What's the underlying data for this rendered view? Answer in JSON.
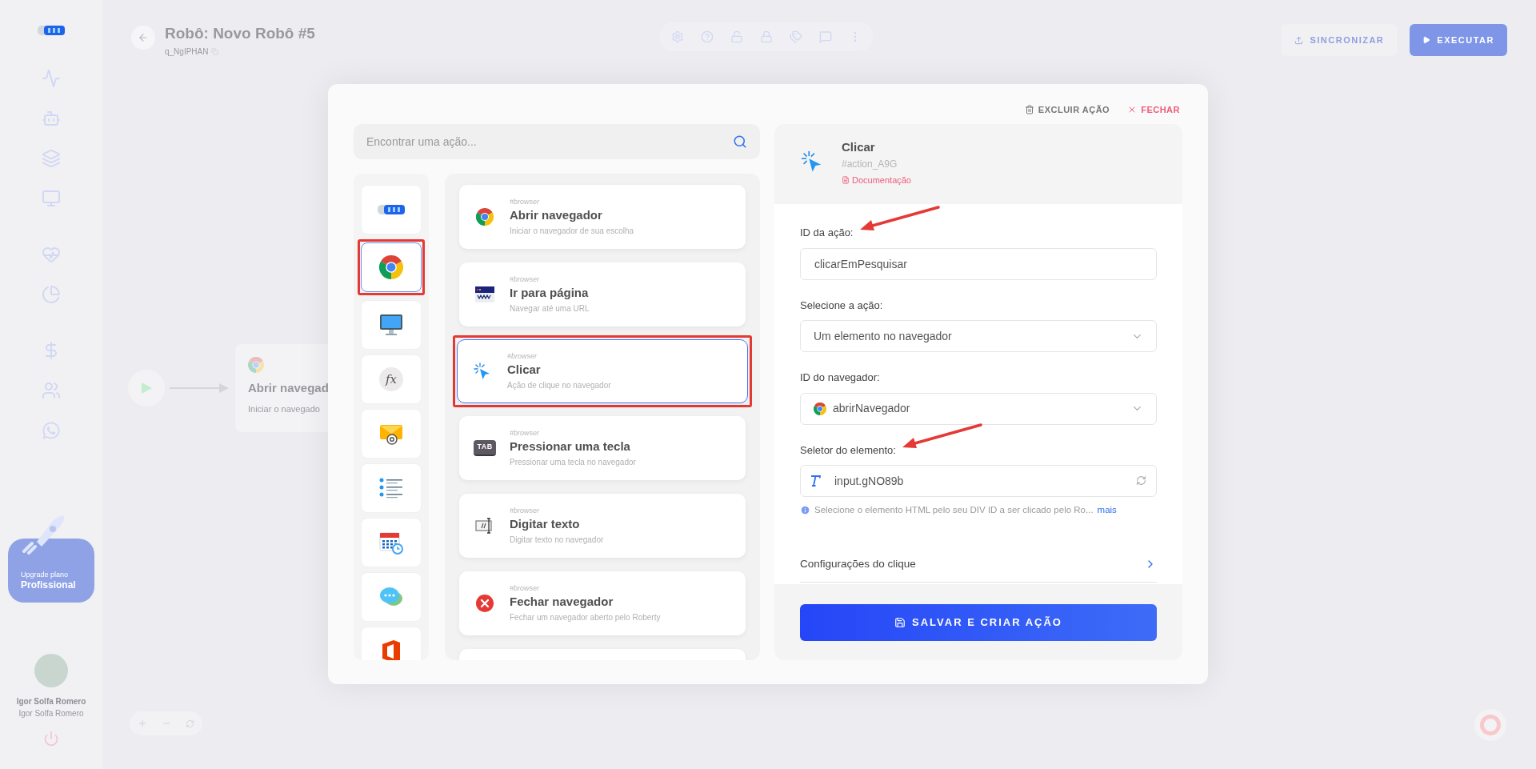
{
  "header": {
    "title": "Robô: Novo Robô #5",
    "robot_id": "q_NgIPHAN"
  },
  "sidebar": {
    "items": [
      {
        "kind": "activity"
      },
      {
        "kind": "robot"
      },
      {
        "kind": "layers"
      },
      {
        "kind": "monitor"
      },
      {
        "kind": "health"
      },
      {
        "kind": "chart"
      },
      {
        "kind": "money"
      },
      {
        "kind": "users"
      },
      {
        "kind": "whatsapp"
      }
    ],
    "upgrade": {
      "line1": "Upgrade plano",
      "line2": "Profissional"
    },
    "user": {
      "name": "Igor Solfa Romero",
      "subtitle": "Igor Solfa Romero"
    }
  },
  "toolbar": [
    {
      "kind": "settings"
    },
    {
      "kind": "help"
    },
    {
      "kind": "unlock"
    },
    {
      "kind": "lock"
    },
    {
      "kind": "tags"
    },
    {
      "kind": "chat"
    },
    {
      "kind": "more"
    }
  ],
  "header_buttons": [
    {
      "label": "SINCRONIZAR",
      "kind": "secondary"
    },
    {
      "label": "EXECUTAR",
      "kind": "primary"
    }
  ],
  "canvas": {
    "node": {
      "title": "Abrir navegad",
      "subtitle": "Iniciar o navegado"
    }
  },
  "modal": {
    "top_actions": [
      {
        "label": "EXCLUIR AÇÃO",
        "kind": "delete"
      },
      {
        "label": "FECHAR",
        "kind": "close"
      }
    ],
    "search": {
      "placeholder": "Encontrar uma ação..."
    },
    "categories": [
      {
        "kind": "scanner",
        "selected": false,
        "highlighted": false
      },
      {
        "kind": "browser",
        "selected": true,
        "highlighted": true
      },
      {
        "kind": "desktop",
        "selected": false,
        "highlighted": false
      },
      {
        "kind": "function",
        "glyph": "fx",
        "selected": false,
        "highlighted": false
      },
      {
        "kind": "email",
        "selected": false,
        "highlighted": false
      },
      {
        "kind": "list",
        "selected": false,
        "highlighted": false
      },
      {
        "kind": "calendar",
        "selected": false,
        "highlighted": false
      },
      {
        "kind": "chat",
        "selected": false,
        "highlighted": false
      },
      {
        "kind": "office",
        "selected": false,
        "highlighted": false
      }
    ],
    "actions": [
      {
        "kind": "open",
        "tag": "#browser",
        "title": "Abrir navegador",
        "description": "Iniciar o navegador de sua escolha",
        "selected": false,
        "highlighted": false
      },
      {
        "kind": "goto",
        "tag": "#browser",
        "title": "Ir para página",
        "description": "Navegar até uma URL",
        "selected": false,
        "highlighted": false
      },
      {
        "kind": "click",
        "tag": "#browser",
        "title": "Clicar",
        "description": "Ação de clique no navegador",
        "selected": true,
        "highlighted": true
      },
      {
        "kind": "key",
        "glyph": "TAB",
        "tag": "#browser",
        "title": "Pressionar uma tecla",
        "description": "Pressionar uma tecla no navegador",
        "selected": false,
        "highlighted": false
      },
      {
        "kind": "type",
        "tag": "#browser",
        "title": "Digitar texto",
        "description": "Digitar texto no navegador",
        "selected": false,
        "highlighted": false
      },
      {
        "kind": "close",
        "tag": "#browser",
        "title": "Fechar navegador",
        "description": "Fechar um navegador aberto pelo Roberty",
        "selected": false,
        "highlighted": false
      }
    ],
    "detail": {
      "title": "Clicar",
      "action_id": "#action_A9G",
      "doc_link": "Documentação",
      "fields": [
        {
          "kind": "text",
          "label": "ID da ação:",
          "value": "clicarEmPesquisar",
          "annotated": true
        },
        {
          "kind": "select",
          "label": "Selecione a ação:",
          "value": "Um elemento no navegador",
          "annotated": false
        },
        {
          "kind": "browser_select",
          "label": "ID do navegador:",
          "value": "abrirNavegador",
          "annotated": false
        },
        {
          "kind": "selector",
          "label": "Seletor do elemento:",
          "value": "input.gNO89b",
          "annotated": true
        }
      ],
      "hint": {
        "text": "Selecione o elemento HTML pelo seu DIV ID a ser clicado pelo Ro...",
        "link": "mais"
      },
      "section": "Configurações do clique",
      "save": "SALVAR E CRIAR AÇÃO"
    }
  }
}
